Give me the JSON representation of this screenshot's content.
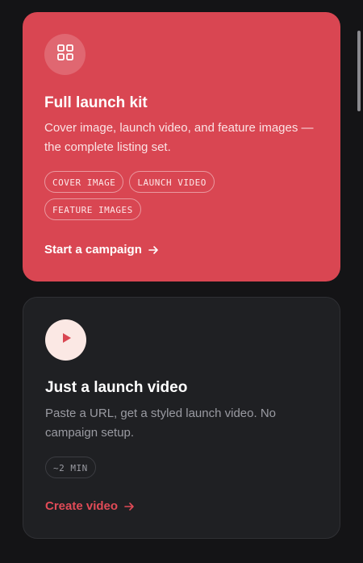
{
  "cards": [
    {
      "icon": "grid-icon",
      "title": "Full launch kit",
      "description": "Cover image, launch video, and feature images — the complete listing set.",
      "tags": [
        "COVER IMAGE",
        "LAUNCH VIDEO",
        "FEATURE IMAGES"
      ],
      "cta": "Start a campaign",
      "background": "#d94652"
    },
    {
      "icon": "play-icon",
      "title": "Just a launch video",
      "description": "Paste a URL, get a styled launch video. No campaign setup.",
      "tags": [
        "~2 MIN"
      ],
      "cta": "Create video",
      "background": "#1f2023",
      "accent": "#e24b57"
    }
  ]
}
